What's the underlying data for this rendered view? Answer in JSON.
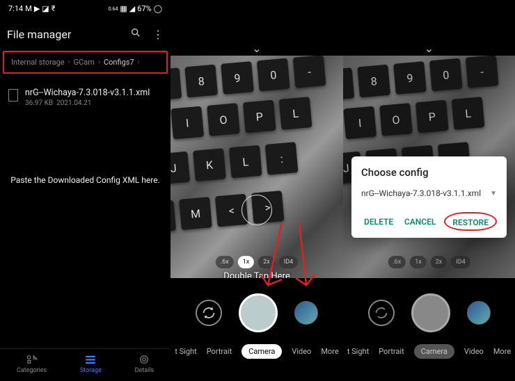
{
  "status": {
    "time": "7:14",
    "battery": "67%",
    "data_label": "0.64"
  },
  "file_app": {
    "title": "File manager",
    "breadcrumb": [
      "Internal storage",
      "GCam",
      "Configs7"
    ],
    "file": {
      "name": "nrG--Wichaya-7.3.018-v3.1.1.xml",
      "size": "36.97 KB",
      "date": "2021.04.21"
    },
    "hint": "Paste the Downloaded Config XML here.",
    "nav": {
      "categories": "Categories",
      "storage": "Storage",
      "details": "Details"
    }
  },
  "camera": {
    "double_tap": "Double Tap Here",
    "zoom": [
      ".6x",
      "1x",
      "2x",
      "ID4"
    ],
    "zoom_right": [
      ".6x",
      "1x",
      "2x",
      "ID4"
    ],
    "modes": [
      "t Sight",
      "Portrait",
      "Camera",
      "Video",
      "More"
    ],
    "modes_right": [
      "t Sight",
      "Portrait",
      "Camera",
      "Video",
      "More"
    ]
  },
  "dialog": {
    "title": "Choose config",
    "selected": "nrG--Wichaya-7.3.018-v3.1.1.xml",
    "delete": "DELETE",
    "cancel": "CANCEL",
    "restore": "RESTORE"
  }
}
